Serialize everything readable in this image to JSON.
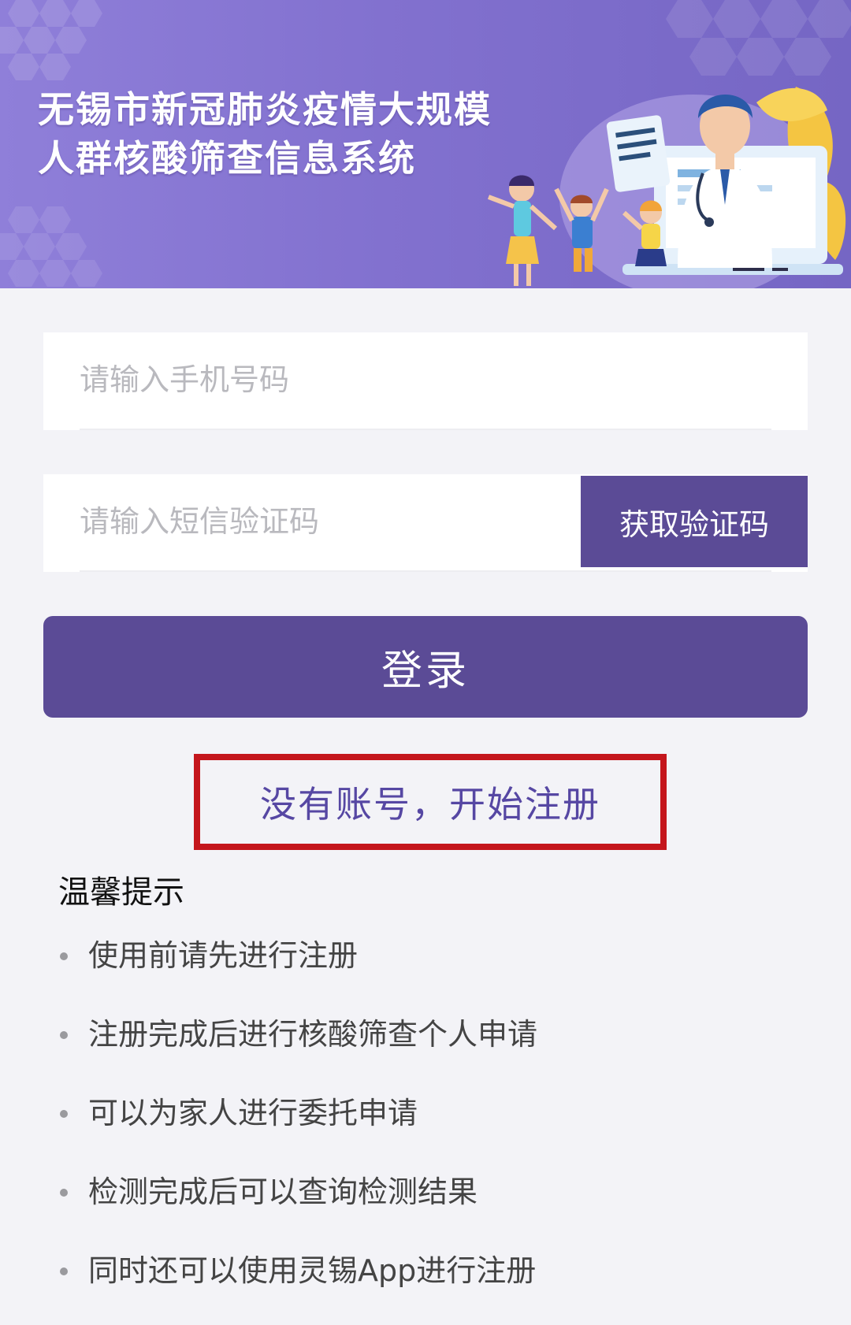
{
  "banner": {
    "title_line1": "无锡市新冠肺炎疫情大规模",
    "title_line2": "人群核酸筛查信息系统",
    "illustration": "doctor-family-illustration"
  },
  "form": {
    "phone_placeholder": "请输入手机号码",
    "phone_value": "",
    "code_placeholder": "请输入短信验证码",
    "code_value": "",
    "get_code_label": "获取验证码",
    "login_label": "登录",
    "register_label": "没有账号，开始注册"
  },
  "tips": {
    "title": "温馨提示",
    "items": [
      "使用前请先进行注册",
      "注册完成后进行核酸筛查个人申请",
      "可以为家人进行委托申请",
      "检测完成后可以查询检测结果",
      "同时还可以使用灵锡App进行注册"
    ]
  },
  "colors": {
    "primary": "#5b4b96",
    "banner": "#8271cf",
    "highlight_border": "#c4161c",
    "link": "#5647a3",
    "background": "#f3f3f7"
  }
}
